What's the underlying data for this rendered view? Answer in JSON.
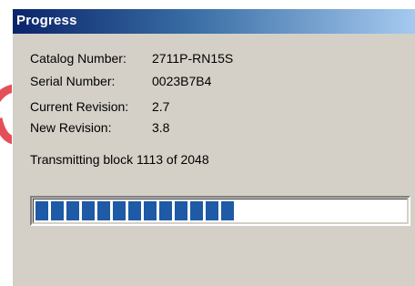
{
  "window": {
    "title": "Progress"
  },
  "details": {
    "catalog_label": "Catalog Number:",
    "catalog_value": "2711P-RN15S",
    "serial_label": "Serial Number:",
    "serial_value": "0023B7B4",
    "current_rev_label": "Current Revision:",
    "current_rev_value": "2.7",
    "new_rev_label": "New Revision:",
    "new_rev_value": "3.8"
  },
  "status": {
    "text": "Transmitting block 1113 of 2048"
  },
  "progress": {
    "current_block": 1113,
    "total_blocks": 2048,
    "fraction": 0.543
  },
  "colors": {
    "titlebar_start": "#0a246a",
    "titlebar_end": "#a6caf0",
    "progress_fill": "#1e5aa5",
    "window_face": "#d4d0c8",
    "watermark": "#e0303a"
  }
}
